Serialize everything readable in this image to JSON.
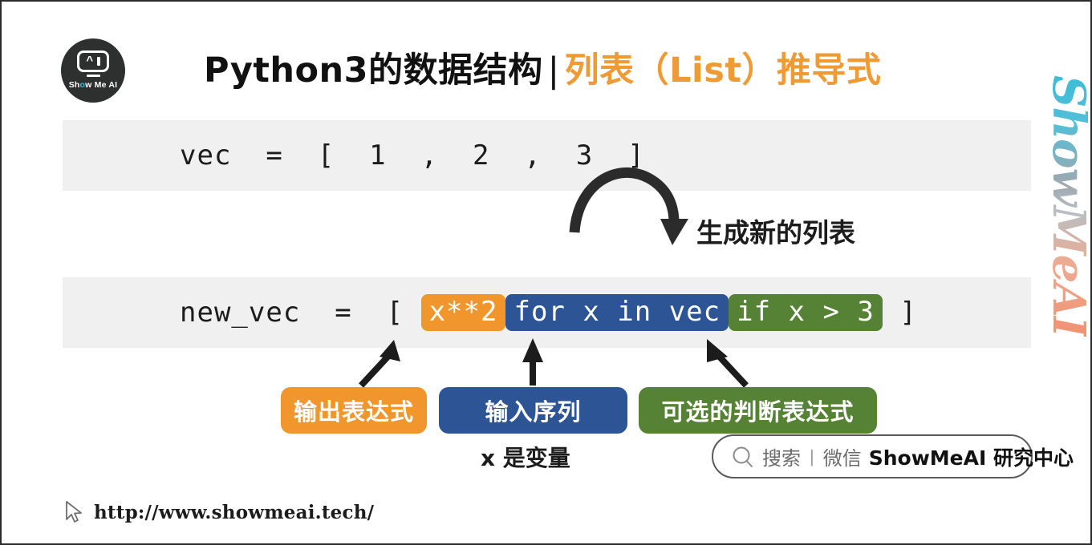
{
  "brand": {
    "logo_text_prefix": "Sh",
    "logo_text_dot": "o",
    "logo_text_suffix": "w Me AI",
    "watermark": "ShowMeAI"
  },
  "header": {
    "title_main": "Python3的数据结构",
    "title_separator": "|",
    "title_accent": "列表（List）推导式"
  },
  "code_blocks": [
    {
      "id": "block-1",
      "text": "vec  =  [  1  ,  2  ,  3  ]"
    },
    {
      "id": "block-2",
      "prefix": "new_vec  =  [ ",
      "chip_output": "x**2",
      "chip_input": "for x in vec",
      "chip_condition": "if x > 3",
      "suffix": " ]"
    }
  ],
  "annotations": {
    "new_list_caption": "生成新的列表",
    "variable_caption": "x 是变量"
  },
  "labels": {
    "output_expression": "输出表达式",
    "input_sequence": "输入序列",
    "optional_condition": "可选的判断表达式"
  },
  "search_badge": {
    "search_word": "搜索",
    "separator": "|",
    "channel": "微信",
    "account": "ShowMeAI 研究中心"
  },
  "footer": {
    "url": "http://www.showmeai.tech/"
  },
  "colors": {
    "orange": "#f0962d",
    "blue": "#2d5494",
    "green": "#558234",
    "title_accent": "#ef9a33",
    "code_bg": "#f0f0f0",
    "ink": "#1c1c1c"
  }
}
